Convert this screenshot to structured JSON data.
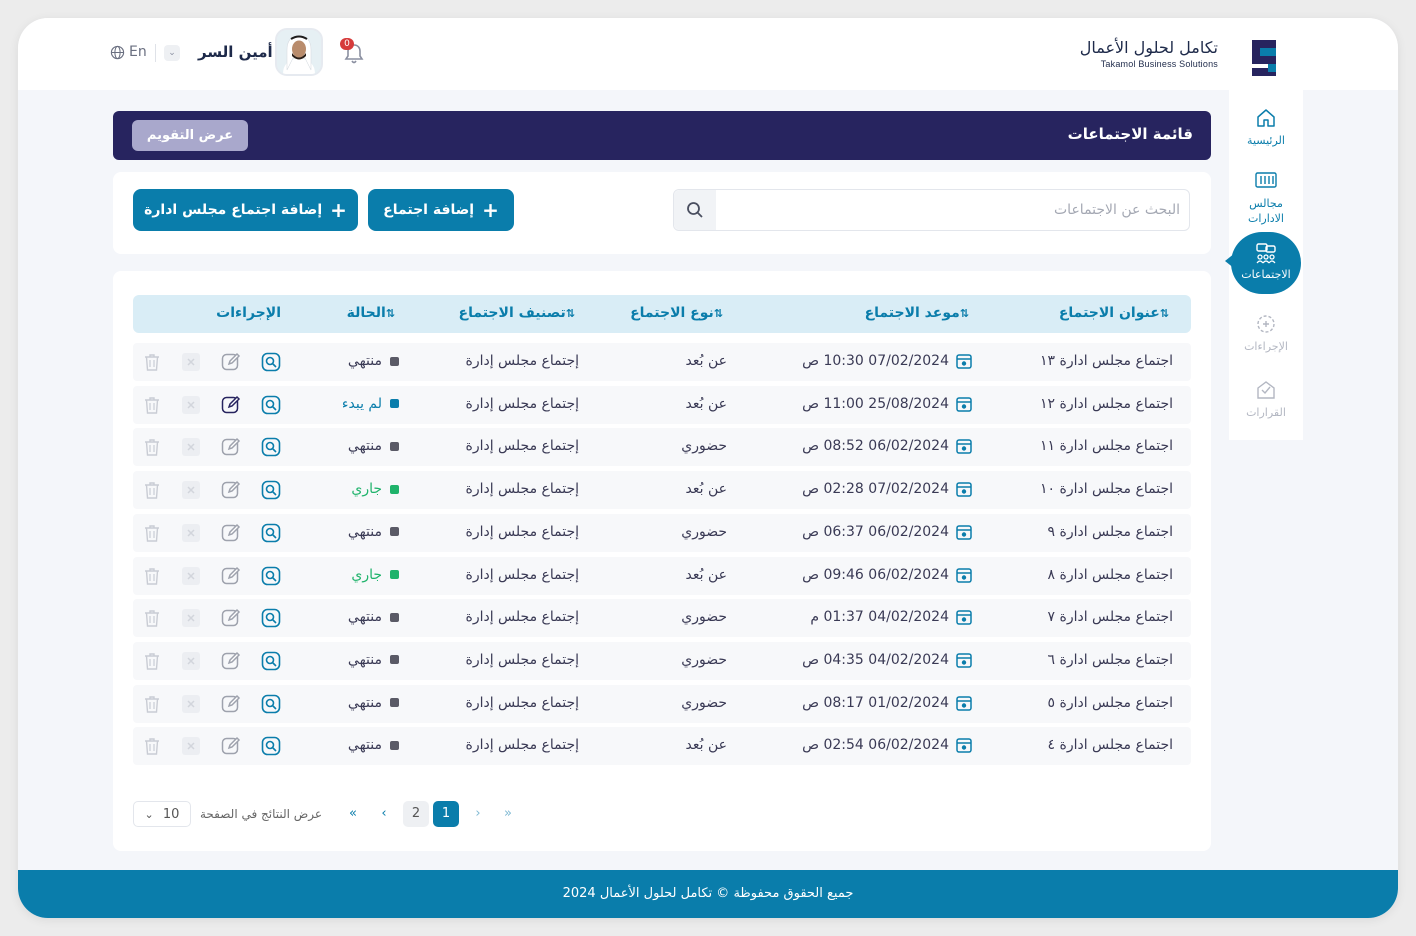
{
  "header": {
    "brand_ar": "تكامل لحلول الأعمال",
    "brand_en": "Takamol Business Solutions",
    "notification_count": "0",
    "user_name": "أمين السر",
    "language": "En"
  },
  "sidebar": {
    "items": [
      {
        "label": "الرئيسية",
        "icon": "home-icon"
      },
      {
        "label": "مجالس الادارات",
        "icon": "boards-icon"
      },
      {
        "label": "الاجتماعات",
        "icon": "meetings-icon",
        "active": true
      },
      {
        "label": "الإجراءات",
        "icon": "actions-icon"
      },
      {
        "label": "القرارات",
        "icon": "decisions-icon"
      }
    ]
  },
  "page": {
    "title": "قائمة الاجتماعات",
    "calendar_button": "عرض التقويم"
  },
  "toolbar": {
    "search_placeholder": "البحث عن الاجتماعات",
    "add_meeting": "إضافة اجتماع",
    "add_board_meeting": "إضافة اجتماع مجلس ادارة"
  },
  "table": {
    "columns": {
      "title": "عنوان الاجتماع",
      "date": "موعد الاجتماع",
      "type": "نوع الاجتماع",
      "category": "تصنيف الاجتماع",
      "status": "الحالة",
      "actions": "الإجراءات"
    },
    "rows": [
      {
        "title": "اجتماع مجلس ادارة ١٣",
        "date": "07/02/2024 10:30 ص",
        "type": "عن بُعد",
        "category": "إجتماع مجلس إدارة",
        "status": "منتهي",
        "status_kind": "ended"
      },
      {
        "title": "اجتماع مجلس ادارة ١٢",
        "date": "25/08/2024 11:00 ص",
        "type": "عن بُعد",
        "category": "إجتماع مجلس إدارة",
        "status": "لم يبدء",
        "status_kind": "notstarted"
      },
      {
        "title": "اجتماع مجلس ادارة ١١",
        "date": "06/02/2024 08:52 ص",
        "type": "حضوري",
        "category": "إجتماع مجلس إدارة",
        "status": "منتهي",
        "status_kind": "ended"
      },
      {
        "title": "اجتماع مجلس ادارة ١٠",
        "date": "07/02/2024 02:28 ص",
        "type": "عن بُعد",
        "category": "إجتماع مجلس إدارة",
        "status": "جاري",
        "status_kind": "running"
      },
      {
        "title": "اجتماع مجلس ادارة ٩",
        "date": "06/02/2024 06:37 ص",
        "type": "حضوري",
        "category": "إجتماع مجلس إدارة",
        "status": "منتهي",
        "status_kind": "ended"
      },
      {
        "title": "اجتماع مجلس ادارة ٨",
        "date": "06/02/2024 09:46 ص",
        "type": "عن بُعد",
        "category": "إجتماع مجلس إدارة",
        "status": "جاري",
        "status_kind": "running"
      },
      {
        "title": "اجتماع مجلس ادارة ٧",
        "date": "04/02/2024 01:37 م",
        "type": "حضوري",
        "category": "إجتماع مجلس إدارة",
        "status": "منتهي",
        "status_kind": "ended"
      },
      {
        "title": "اجتماع مجلس ادارة ٦",
        "date": "04/02/2024 04:35 ص",
        "type": "حضوري",
        "category": "إجتماع مجلس إدارة",
        "status": "منتهي",
        "status_kind": "ended"
      },
      {
        "title": "اجتماع مجلس ادارة ٥",
        "date": "01/02/2024 08:17 ص",
        "type": "حضوري",
        "category": "إجتماع مجلس إدارة",
        "status": "منتهي",
        "status_kind": "ended"
      },
      {
        "title": "اجتماع مجلس ادارة ٤",
        "date": "06/02/2024 02:54 ص",
        "type": "عن بُعد",
        "category": "إجتماع مجلس إدارة",
        "status": "منتهي",
        "status_kind": "ended"
      }
    ]
  },
  "pagination": {
    "per_page": "10",
    "per_page_label": "عرض النتائج في الصفحة",
    "pages": [
      "1",
      "2"
    ],
    "current_page": "1"
  },
  "footer": {
    "text": "جميع الحقوق محفوظة © تكامل لحلول الأعمال 2024"
  },
  "colors": {
    "primary": "#0a7dab",
    "title_bar": "#27245f",
    "status_ended": "#5a5a66",
    "status_notstarted": "#0a7dab",
    "status_running": "#1fb36b"
  }
}
